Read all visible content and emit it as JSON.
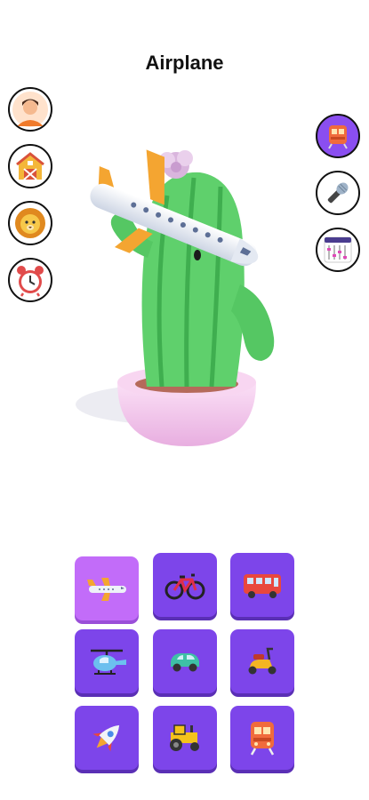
{
  "header": {
    "title": "Airplane"
  },
  "left_buttons": [
    {
      "name": "person-icon"
    },
    {
      "name": "barn-icon"
    },
    {
      "name": "lion-icon"
    },
    {
      "name": "alarm-clock-icon"
    }
  ],
  "right_buttons": [
    {
      "name": "train-icon",
      "active": true
    },
    {
      "name": "microphone-icon",
      "active": false
    },
    {
      "name": "mixer-icon",
      "active": false
    }
  ],
  "vehicle_grid": [
    {
      "name": "airplane-icon",
      "selected": true
    },
    {
      "name": "bicycle-icon",
      "selected": false
    },
    {
      "name": "bus-icon",
      "selected": false
    },
    {
      "name": "helicopter-icon",
      "selected": false
    },
    {
      "name": "car-icon",
      "selected": false
    },
    {
      "name": "scooter-icon",
      "selected": false
    },
    {
      "name": "rocket-icon",
      "selected": false
    },
    {
      "name": "tractor-icon",
      "selected": false
    },
    {
      "name": "train-icon",
      "selected": false
    }
  ],
  "colors": {
    "tile": "#7d45ea",
    "tile_selected": "#c26cf9",
    "cactus": "#5fd06c",
    "pot": "#f2c6ec"
  }
}
